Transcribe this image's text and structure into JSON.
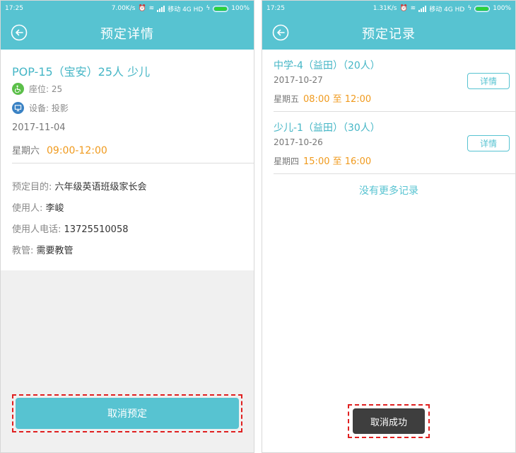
{
  "left": {
    "status": {
      "time": "17:25",
      "speed": "7.00K/s",
      "carrier": "移动 4G HD",
      "battery": "100%"
    },
    "title": "预定详情",
    "room_name": "POP-15（宝安）25人 少儿",
    "seats": "座位: 25",
    "equipment": "设备: 投影",
    "date": "2017-11-04",
    "weekday": "星期六",
    "time_range": "09:00-12:00",
    "purpose_label": "预定目的: ",
    "purpose_value": "六年级英语班级家长会",
    "user_label": "使用人: ",
    "user_value": "李峻",
    "phone_label": "使用人电话: ",
    "phone_value": "13725510058",
    "admin_label": "教管: ",
    "admin_value": "需要教管",
    "cancel_button": "取消预定",
    "colors": {
      "accent": "#57c3d1",
      "time": "#f09a1d",
      "seat_icon": "#5cbf4a",
      "equip_icon": "#3a82c4",
      "highlight": "#e02020"
    },
    "icons": [
      "back-icon",
      "wheelchair-icon",
      "monitor-icon"
    ]
  },
  "right": {
    "status": {
      "time": "17:25",
      "speed": "1.31K/s",
      "carrier": "移动 4G HD",
      "battery": "100%"
    },
    "title": "预定记录",
    "records": [
      {
        "name": "中学-4（益田）（20人）",
        "date": "2017-10-27",
        "weekday": "星期五",
        "time_range": "08:00 至 12:00",
        "detail_label": "详情"
      },
      {
        "name": "少儿-1（益田）（30人）",
        "date": "2017-10-26",
        "weekday": "星期四",
        "time_range": "15:00 至 16:00",
        "detail_label": "详情"
      }
    ],
    "no_more": "没有更多记录",
    "toast": "取消成功"
  }
}
